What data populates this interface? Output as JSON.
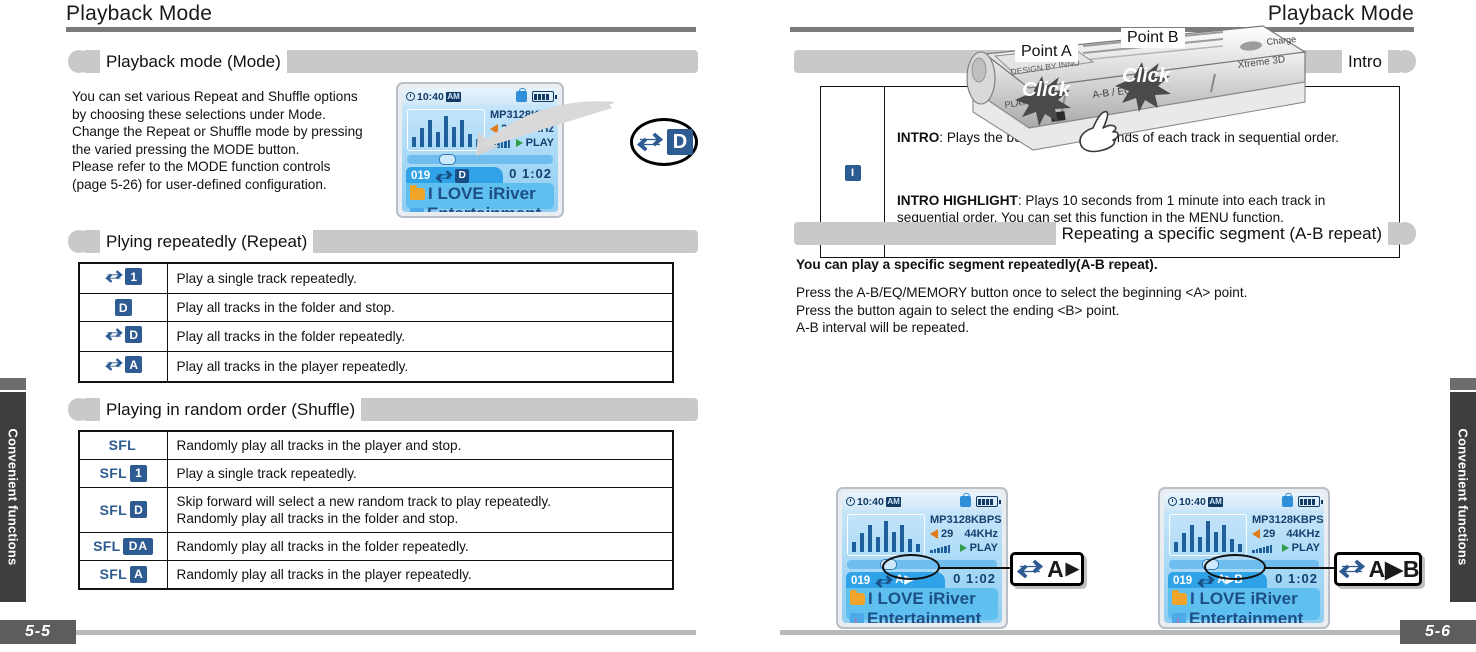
{
  "meta": {
    "accent_blue": "#2e5b91",
    "bar_gray": "#c9c9c9",
    "rule_gray": "#7b7b7b"
  },
  "left_page": {
    "running_head": "Playback Mode",
    "page_number": "5-5",
    "side_tab": "Convenient functions",
    "sections": [
      {
        "title": "Playback mode (Mode)"
      },
      {
        "title": "Plying repeatedly (Repeat)"
      },
      {
        "title": "Playing in random order (Shuffle)"
      }
    ],
    "intro_paragraph": "You can set various Repeat and Shuffle options\nby choosing these selections under Mode.\nChange the Repeat or Shuffle mode by pressing\nthe varied pressing the MODE button.\nPlease refer to the MODE function controls\n(page 5-26) for user-defined configuration.",
    "callout_badge": {
      "icon": "repeat-arrows",
      "label": "D"
    },
    "repeat_table": {
      "rows": [
        {
          "icon": "repeat-arrows",
          "badge": "1",
          "desc": "Play a single track repeatedly."
        },
        {
          "icon": "none",
          "badge": "D",
          "desc": "Play all tracks in the folder and stop."
        },
        {
          "icon": "repeat-arrows",
          "badge": "D",
          "desc": "Play all tracks in the folder repeatedly."
        },
        {
          "icon": "repeat-arrows",
          "badge": "A",
          "desc": "Play all tracks in the player repeatedly."
        }
      ]
    },
    "shuffle_table": {
      "rows": [
        {
          "prefix": "SFL",
          "badge": "",
          "desc": "Randomly play all tracks in the player and stop."
        },
        {
          "prefix": "SFL",
          "badge": "1",
          "desc": "Play a single track repeatedly."
        },
        {
          "prefix": "SFL",
          "badge": "D",
          "desc": "Skip forward will select a new random track to play repeatedly.\nRandomly play all tracks in the folder and stop."
        },
        {
          "prefix": "SFL",
          "badge": "DA",
          "desc": "Randomly play all tracks in the folder repeatedly."
        },
        {
          "prefix": "SFL",
          "badge": "A",
          "desc": "Randomly play all tracks in the player repeatedly."
        }
      ]
    },
    "lcd": {
      "clock": "10:40",
      "ampm": "AM",
      "format": "MP3",
      "bitrate": "128KBPS",
      "volume": "29",
      "samplerate": "44KHz",
      "play_state": "PLAY",
      "elapsed": "0 1:02",
      "track_number": "019",
      "mode_badge": "D",
      "line1": "I LOVE iRiver",
      "line2": "Entertainment"
    }
  },
  "right_page": {
    "running_head": "Playback Mode",
    "page_number": "5-6",
    "side_tab": "Convenient functions",
    "sections": [
      {
        "title": "Intro"
      },
      {
        "title": "Repeating a specific segment (A-B repeat)"
      }
    ],
    "intro_table": {
      "icon_badge": "I",
      "paragraph1_bold": "INTRO",
      "paragraph1_rest": ": Plays the beginning 10 seconds of each track in sequential order.",
      "paragraph2_bold": "INTRO HIGHLIGHT",
      "paragraph2_rest": ": Plays 10 seconds from 1 minute into each track in sequential order. You can set this function in the MENU function."
    },
    "ab_heading": "You can play a specific segment repeatedly(A-B repeat).",
    "ab_paragraph": "Press the A-B/EQ/MEMORY button once to select the beginning <A> point.\nPress the button again to select the ending <B> point.\nA-B interval will be repeated.",
    "device": {
      "point_a_label": "Point A",
      "point_b_label": "Point B",
      "click_label": "Click",
      "button_label": "A-B / EQ",
      "play_label": "PLAY",
      "design_label": "DESIGN BY INNO",
      "charge_label": "Charge",
      "xtreme_label": "Xtreme 3D"
    },
    "lcd_a": {
      "clock": "10:40",
      "ampm": "AM",
      "format": "MP3",
      "bitrate": "128KBPS",
      "volume": "29",
      "samplerate": "44KHz",
      "play_state": "PLAY",
      "elapsed": "0 1:02",
      "track_number": "019",
      "mode_badge": "A",
      "mode_badge_suffix": "▶",
      "line1": "I LOVE iRiver",
      "line2": "Entertainment"
    },
    "lcd_b": {
      "clock": "10:40",
      "ampm": "AM",
      "format": "MP3",
      "bitrate": "128KBPS",
      "volume": "29",
      "samplerate": "44KHz",
      "play_state": "PLAY",
      "elapsed": "0 1:02",
      "track_number": "019",
      "mode_badge": "A▶B",
      "line1": "I LOVE iRiver",
      "line2": "Entertainment"
    },
    "callout_a": {
      "letter": "A",
      "suffix": "▶"
    },
    "callout_b": {
      "letter": "A▶B"
    }
  }
}
